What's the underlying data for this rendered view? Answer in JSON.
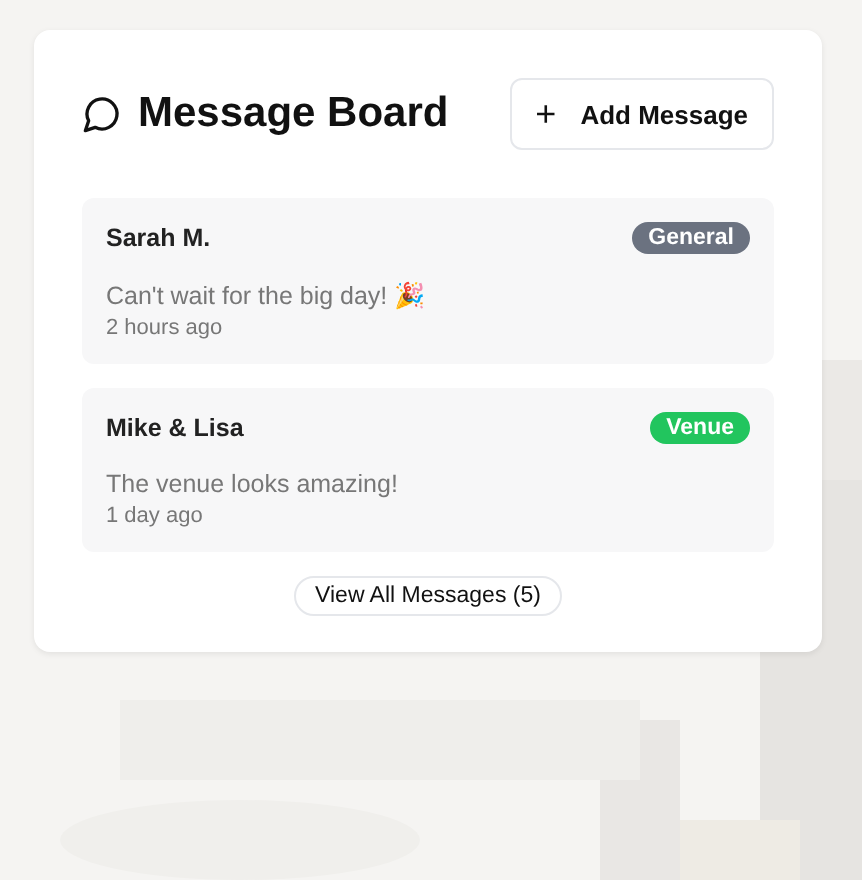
{
  "header": {
    "title": "Message Board",
    "add_button": "+",
    "add_label": "Add Message"
  },
  "messages": [
    {
      "author": "Sarah M.",
      "tag": "General",
      "color": "#6b7280",
      "text": "Can't wait for the big day! 🎉",
      "time": "2 hours ago"
    },
    {
      "author": "Mike & Lisa",
      "tag": "Venue",
      "color": "#22c55e",
      "text": "The venue looks amazing!",
      "time": "1 day ago"
    }
  ],
  "view_all": "View All Messages (5)"
}
